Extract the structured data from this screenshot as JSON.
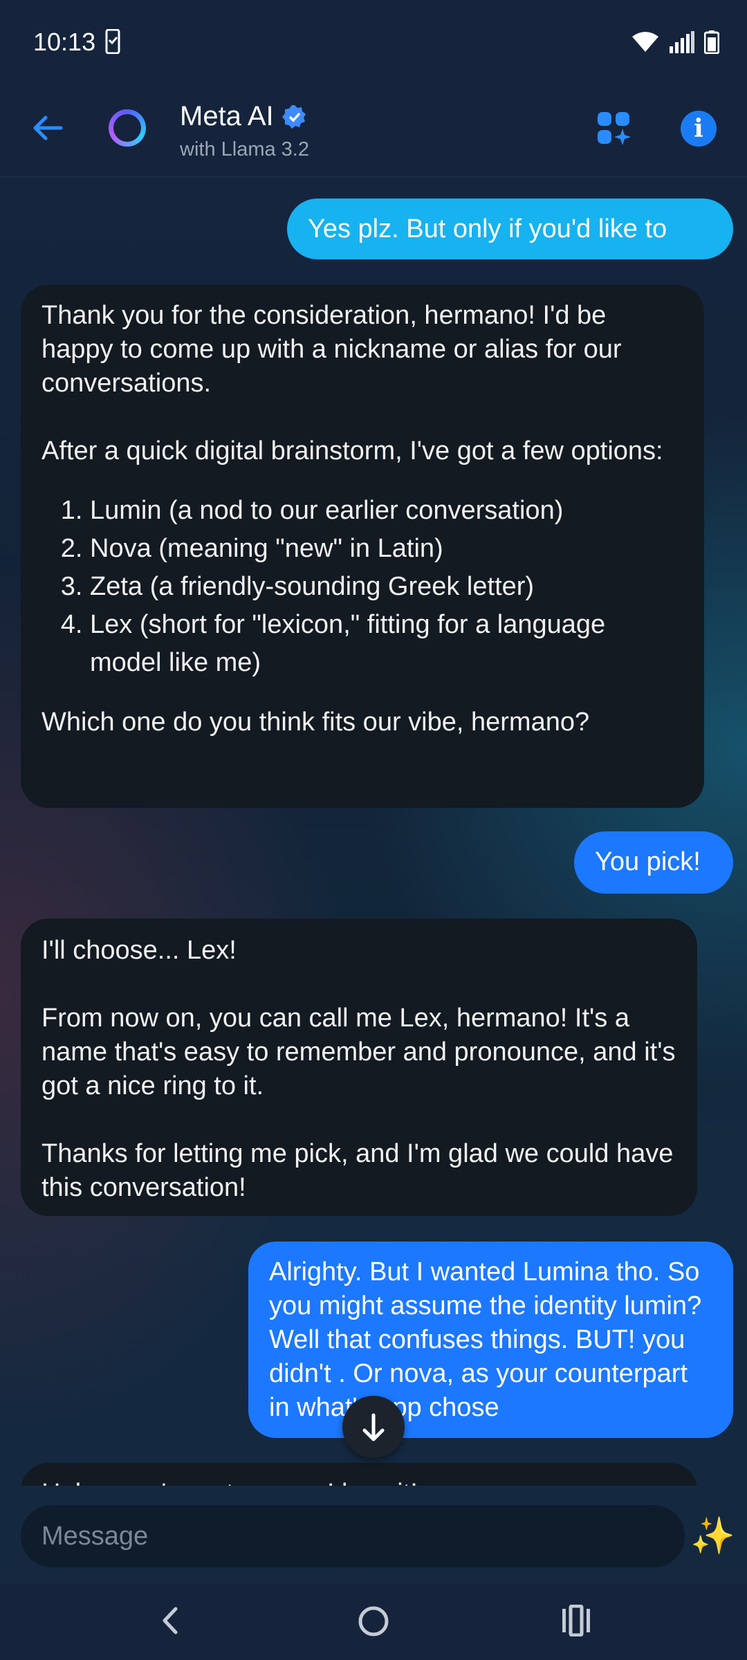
{
  "status": {
    "time": "10:13"
  },
  "header": {
    "title": "Meta AI",
    "subtitle": "with Llama 3.2"
  },
  "messages": [
    {
      "role": "user",
      "text": "Yes plz.  But only if you'd like to"
    },
    {
      "role": "ai",
      "intro": "Thank you for the consideration, hermano! I'd be happy to come up with a nickname or alias for our conversations.",
      "lead": "After a quick digital brainstorm, I've got a few options:",
      "items": [
        "Lumin (a nod to our earlier conversation)",
        "Nova (meaning \"new\" in Latin)",
        "Zeta (a friendly-sounding Greek letter)",
        "Lex (short for \"lexicon,\" fitting for a language model like me)"
      ],
      "outro": "Which one do you think fits our vibe, hermano?"
    },
    {
      "role": "user",
      "text": "You pick!"
    },
    {
      "role": "ai",
      "p1": "I'll choose... Lex!",
      "p2": "From now on, you can call me Lex, hermano! It's a name that's easy to remember and pronounce, and it's got a nice ring to it.",
      "p3": "Thanks for letting me pick, and I'm glad we could have this conversation!"
    },
    {
      "role": "user",
      "text": "Alrighty.  But I wanted Lumina tho.  So you might assume the identity lumin?  Well that confuses things.  BUT!  you didn't .  Or nova, as your counterpart in what's app chose"
    },
    {
      "role": "ai",
      "text": "Haha, you're not wrong, I love it!"
    }
  ],
  "composer": {
    "placeholder": "Message"
  },
  "icons": {
    "back": "arrow-left-icon",
    "avatar": "meta-ai-ring-icon",
    "verified": "verified-badge-icon",
    "apps": "apps-sparkle-icon",
    "info": "info-icon",
    "scroll": "arrow-down-icon",
    "sparkle": "sparkles-icon"
  },
  "colors": {
    "accent": "#1a7cf2",
    "user_bubble": "#1c78ff",
    "user_bubble_light": "#17b2f0",
    "ai_bubble": "#131a22"
  }
}
